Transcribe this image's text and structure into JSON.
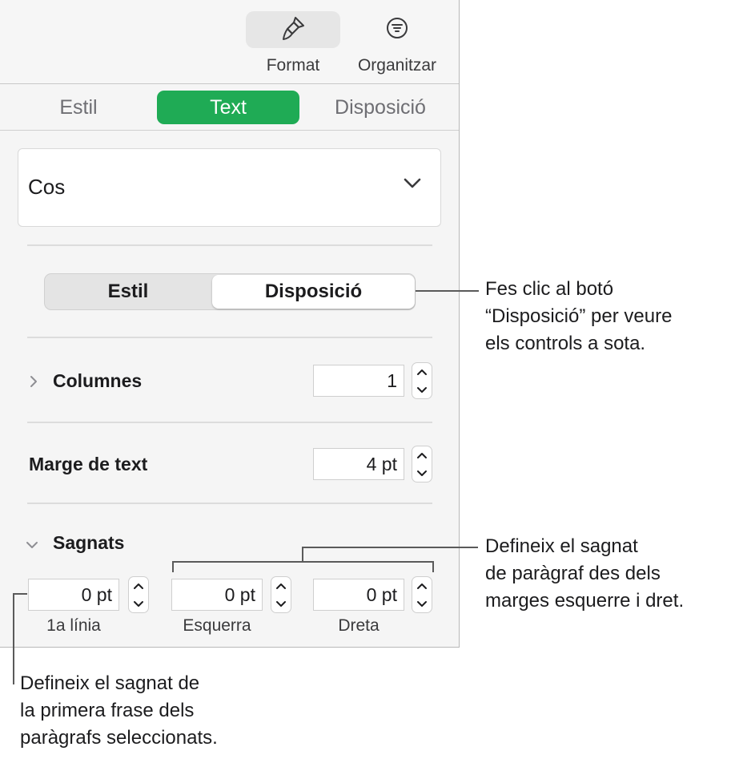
{
  "toolbar": {
    "format_label": "Format",
    "organize_label": "Organitzar",
    "format_icon": "paintbrush-icon",
    "organize_icon": "filter-lines-icon"
  },
  "tabs": [
    {
      "label": "Estil",
      "active": false
    },
    {
      "label": "Text",
      "active": true
    },
    {
      "label": "Disposició",
      "active": false
    }
  ],
  "paragraph_style": {
    "value": "Cos"
  },
  "segmented": {
    "left": "Estil",
    "right": "Disposició",
    "selected": "Disposició"
  },
  "columns": {
    "label": "Columnes",
    "value": "1"
  },
  "text_inset": {
    "label": "Marge de text",
    "value": "4 pt"
  },
  "indents": {
    "label": "Sagnats",
    "first_line": {
      "value": "0 pt",
      "label": "1a línia"
    },
    "left": {
      "value": "0 pt",
      "label": "Esquerra"
    },
    "right": {
      "value": "0 pt",
      "label": "Dreta"
    }
  },
  "callouts": {
    "layout": [
      "Fes clic al botó",
      "“Disposició” per veure",
      "els controls a sota."
    ],
    "margins": [
      "Defineix el sagnat",
      "de paràgraf des dels",
      "marges esquerre i dret."
    ],
    "first_line": [
      "Defineix el sagnat de",
      "la primera frase dels",
      "paràgrafs seleccionats."
    ]
  },
  "colors": {
    "accent": "#1fab55"
  }
}
